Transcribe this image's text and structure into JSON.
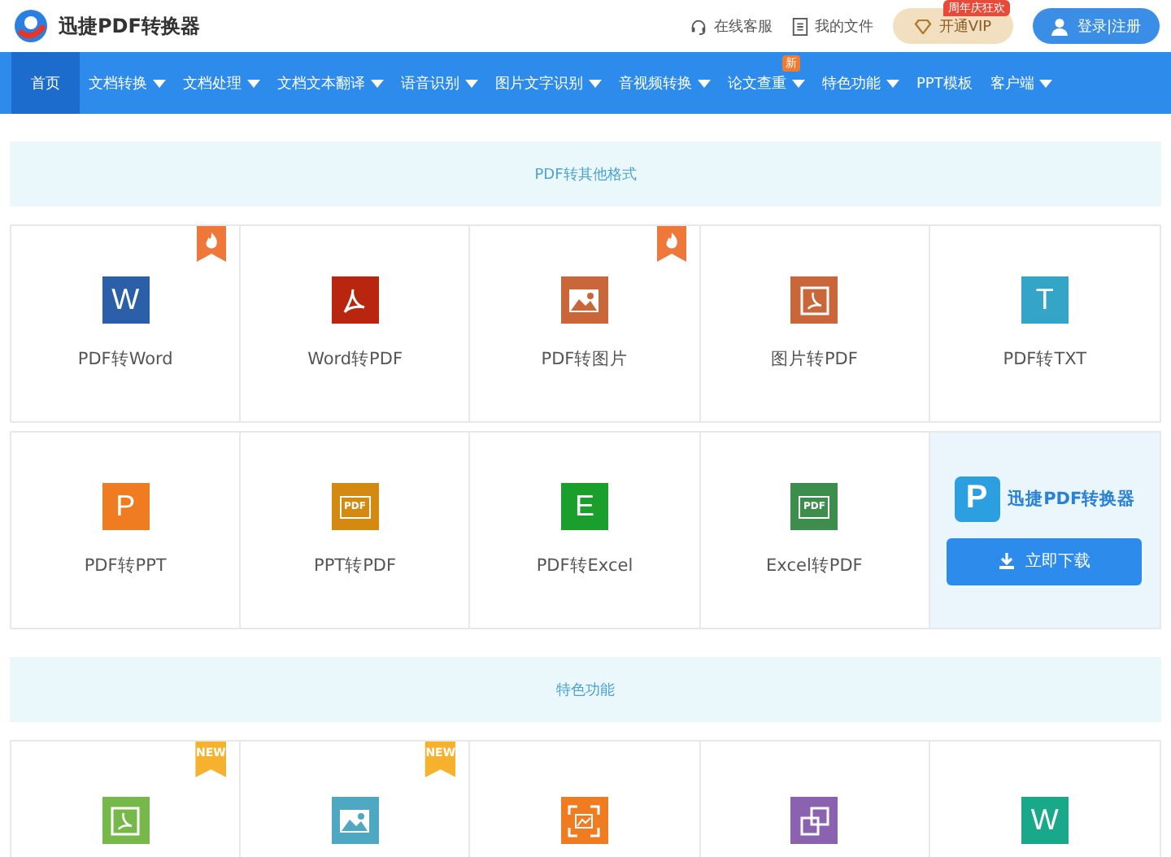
{
  "header": {
    "logo_text": "迅捷PDF转换器",
    "links": [
      {
        "kind": "headset",
        "label": "在线客服"
      },
      {
        "kind": "file",
        "label": "我的文件"
      }
    ],
    "vip": {
      "label": "开通VIP",
      "badge": "周年庆狂欢"
    },
    "login": {
      "label": "登录|注册"
    }
  },
  "nav": [
    {
      "label": "首页",
      "selected": true,
      "caret": false
    },
    {
      "label": "文档转换",
      "selected": false,
      "caret": true
    },
    {
      "label": "文档处理",
      "selected": false,
      "caret": true
    },
    {
      "label": "文档文本翻译",
      "selected": false,
      "caret": true
    },
    {
      "label": "语音识别",
      "selected": false,
      "caret": true
    },
    {
      "label": "图片文字识别",
      "selected": false,
      "caret": true
    },
    {
      "label": "音视频转换",
      "selected": false,
      "caret": true
    },
    {
      "label": "论文查重",
      "selected": false,
      "caret": true,
      "badge": "新"
    },
    {
      "label": "特色功能",
      "selected": false,
      "caret": true
    },
    {
      "label": "PPT模板",
      "selected": false,
      "caret": false
    },
    {
      "label": "客户端",
      "selected": false,
      "caret": true
    }
  ],
  "sections": [
    {
      "title": "PDF转其他格式",
      "rows": [
        [
          {
            "label": "PDF转Word",
            "kind": "letter",
            "glyph": "W",
            "color": "#2b5fa8",
            "hot": true
          },
          {
            "label": "Word转PDF",
            "kind": "acrobat",
            "color": "#b8260f",
            "hot": false
          },
          {
            "label": "PDF转图片",
            "kind": "image",
            "color": "#c9673a",
            "hot": true
          },
          {
            "label": "图片转PDF",
            "kind": "pdfframe",
            "color": "#c9673a",
            "hot": false
          },
          {
            "label": "PDF转TXT",
            "kind": "letter",
            "glyph": "T",
            "color": "#35a5c7",
            "hot": false
          }
        ],
        [
          {
            "label": "PDF转PPT",
            "kind": "letter",
            "glyph": "P",
            "color": "#f07c22",
            "hot": false
          },
          {
            "label": "PPT转PDF",
            "kind": "pdfslide",
            "glyph": "PDF",
            "color": "#d48a10",
            "hot": false
          },
          {
            "label": "PDF转Excel",
            "kind": "letter",
            "glyph": "E",
            "color": "#1a9e2c",
            "hot": false
          },
          {
            "label": "Excel转PDF",
            "kind": "pdfpage",
            "glyph": "PDF",
            "color": "#3d8e4c",
            "hot": false
          }
        ]
      ],
      "promo": {
        "name": "迅捷PDF转换器",
        "glyph": "P",
        "button": "立即下载"
      }
    },
    {
      "title": "特色功能",
      "rows": [
        [
          {
            "kind": "pdfframe",
            "color": "#77b84a",
            "hot": false,
            "badge": "NEW"
          },
          {
            "kind": "image",
            "color": "#4fa8c2",
            "hot": false,
            "badge": "NEW"
          },
          {
            "kind": "scan",
            "color": "#f07c22",
            "hot": false
          },
          {
            "kind": "squares",
            "color": "#8a62b0",
            "hot": false
          },
          {
            "kind": "letter",
            "glyph": "W",
            "color": "#1aa88a",
            "hot": false
          }
        ]
      ]
    }
  ]
}
